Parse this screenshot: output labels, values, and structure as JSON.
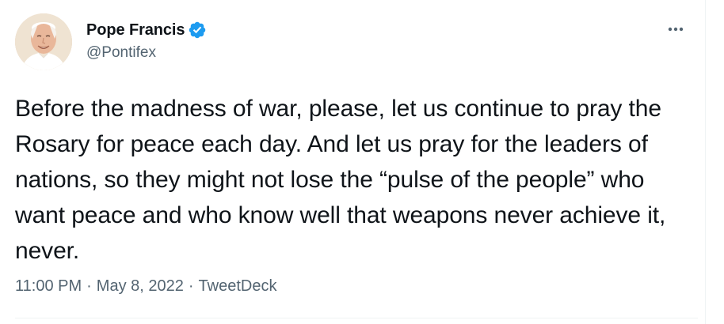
{
  "author": {
    "display_name": "Pope Francis",
    "handle": "@Pontifex",
    "verified": true,
    "avatar_icon": "portrait-avatar"
  },
  "menu": {
    "icon": "more-horizontal-icon"
  },
  "tweet": {
    "text": "Before the madness of war, please, let us continue to pray the Rosary for peace each day. And let us pray for the leaders of nations, so they might not lose the “pulse of the people” who want peace and who know well that weapons never achieve it, never."
  },
  "meta": {
    "time": "11:00 PM",
    "separator": "·",
    "date": "May 8, 2022",
    "source": "TweetDeck"
  },
  "colors": {
    "text_primary": "#0f1419",
    "text_secondary": "#536471",
    "verified_blue": "#1d9bf0",
    "divider": "#eff3f4"
  }
}
